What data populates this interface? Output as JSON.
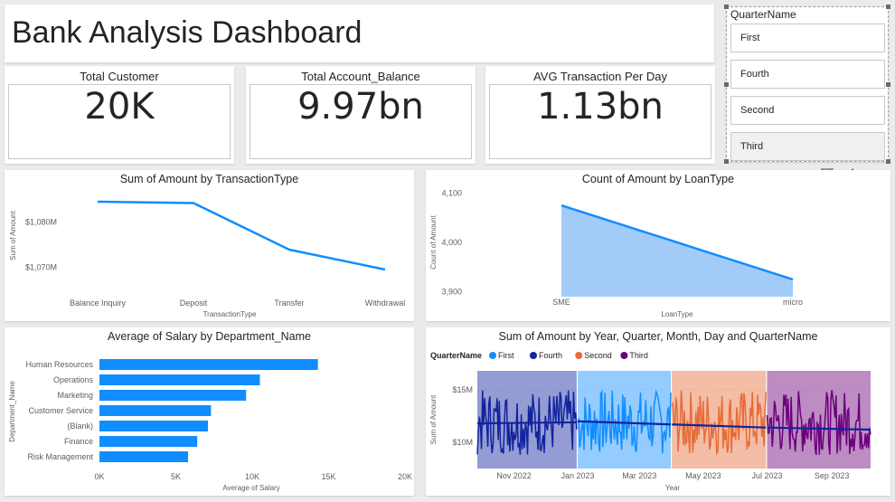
{
  "title": "Bank Analysis Dashboard",
  "kpis": [
    {
      "title": "Total Customer",
      "value": "20K"
    },
    {
      "title": "Total Account_Balance",
      "value": "9.97bn"
    },
    {
      "title": "AVG Transaction Per Day",
      "value": "1.13bn"
    }
  ],
  "slicer": {
    "title": "QuarterName",
    "items": [
      "First",
      "Fourth",
      "Second",
      "Third"
    ],
    "selected": "Third"
  },
  "toolbar_icons": [
    "filter-icon",
    "eraser-icon",
    "more-options-icon"
  ],
  "chart_data": [
    {
      "type": "line",
      "title": "Sum of Amount by TransactionType",
      "xlabel": "TransactionType",
      "ylabel": "Sum of Amount",
      "categories": [
        "Balance Inquiry",
        "Deposit",
        "Transfer",
        "Withdrawal"
      ],
      "values": [
        1084.5,
        1084.2,
        1073.9,
        1069.5
      ],
      "yticks": [
        "$1,080M",
        "$1,070M"
      ],
      "ytick_values": [
        1080,
        1070
      ],
      "ylim": [
        1066.5,
        1087.5
      ],
      "color": "#118dff"
    },
    {
      "type": "area",
      "title": "Count of Amount by LoanType",
      "xlabel": "LoanType",
      "ylabel": "Count of Amount",
      "categories": [
        "SME",
        "micro"
      ],
      "values": [
        4075,
        3925
      ],
      "yticks": [
        "4,100",
        "4,000",
        "3,900"
      ],
      "ytick_values": [
        4100,
        4000,
        3900
      ],
      "ylim": [
        3890,
        4110
      ],
      "color": "#118dff",
      "fill": "#9dc9f7"
    },
    {
      "type": "bar",
      "orientation": "horizontal",
      "title": "Average of Salary by Department_Name",
      "xlabel": "Average of Salary",
      "ylabel": "Department_Name",
      "categories": [
        "Human Resources",
        "Operations",
        "Marketing",
        "Customer Service",
        "(Blank)",
        "Finance",
        "Risk Management"
      ],
      "values": [
        14300,
        10500,
        9600,
        7300,
        7100,
        6400,
        5800
      ],
      "xticks": [
        "0K",
        "5K",
        "10K",
        "15K",
        "20K"
      ],
      "xtick_values": [
        0,
        5000,
        10000,
        15000,
        20000
      ],
      "xlim": [
        0,
        20000
      ],
      "color": "#118dff"
    },
    {
      "type": "line",
      "title": "Sum of Amount by Year, Quarter, Month, Day and QuarterName",
      "xlabel": "Year",
      "ylabel": "Sum of Amount",
      "legend_title": "QuarterName",
      "legend_position": "top-left",
      "xticks": [
        "Nov 2022",
        "Jan 2023",
        "Mar 2023",
        "May 2023",
        "Jul 2023",
        "Sep 2023"
      ],
      "yticks": [
        "$15M",
        "$10M"
      ],
      "ytick_values": [
        15,
        10
      ],
      "ylim": [
        7.5,
        16.8
      ],
      "x_start": "2022-09-27",
      "x_end": "2023-10-08",
      "series": [
        {
          "name": "First",
          "color": "#118dff",
          "start": "2023-01-01",
          "end": "2023-03-31",
          "trend": [
            12.0,
            11.7
          ]
        },
        {
          "name": "Fourth",
          "color": "#12239e",
          "start": "2022-09-27",
          "end": "2022-12-31",
          "trend": [
            11.8,
            11.9
          ]
        },
        {
          "name": "Second",
          "color": "#e66c37",
          "start": "2023-04-01",
          "end": "2023-06-30",
          "trend": [
            11.7,
            11.4
          ]
        },
        {
          "name": "Third",
          "color": "#6b007b",
          "start": "2023-07-01",
          "end": "2023-10-08",
          "trend": [
            11.4,
            11.2
          ]
        }
      ]
    }
  ]
}
